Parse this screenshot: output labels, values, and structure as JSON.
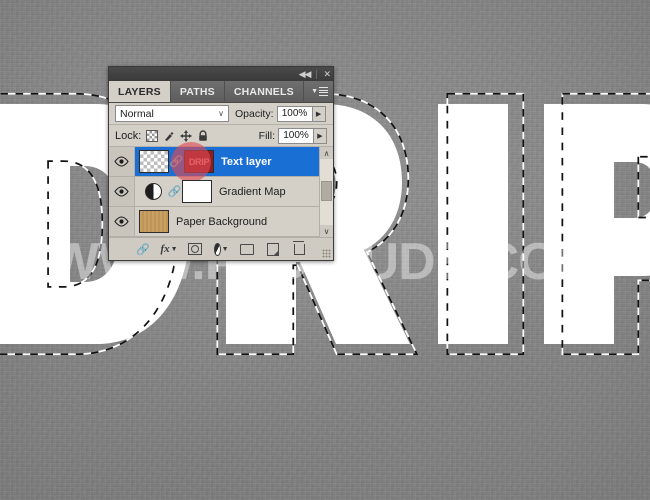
{
  "canvas": {
    "artwork_text": "DRIP",
    "watermark": "WWW.PSD-DUDE.COM",
    "background_color": "#8e8e8e",
    "letter_fill_color": "#ffffff"
  },
  "panel": {
    "titlebar": {
      "collapse_label": "◀◀",
      "close_label": "✕"
    },
    "tabs": [
      {
        "label": "LAYERS",
        "active": true
      },
      {
        "label": "PATHS",
        "active": false
      },
      {
        "label": "CHANNELS",
        "active": false
      }
    ],
    "blend_mode": {
      "value": "Normal",
      "chevron": "∨"
    },
    "opacity": {
      "label": "Opacity:",
      "value": "100%",
      "arrow": "▶"
    },
    "fill": {
      "label": "Fill:",
      "value": "100%",
      "arrow": "▶"
    },
    "lock": {
      "label": "Lock:"
    },
    "layers": [
      {
        "name": "Text layer",
        "visible": true,
        "selected": true,
        "thumb_type": "checker",
        "badge_text": "DRIP",
        "has_link": true
      },
      {
        "name": "Gradient Map",
        "visible": true,
        "selected": false,
        "thumb_type": "adjustment",
        "has_link": true
      },
      {
        "name": "Paper Background",
        "visible": true,
        "selected": false,
        "thumb_type": "paper",
        "has_link": false
      }
    ],
    "scrollbar": {
      "up": "∧",
      "down": "∨"
    },
    "footer_icons": [
      "link-icon",
      "fx-icon",
      "layer-mask-icon",
      "adjustment-layer-icon",
      "new-group-icon",
      "new-layer-icon",
      "delete-layer-icon"
    ],
    "selection_color": "#1a6fd4"
  }
}
